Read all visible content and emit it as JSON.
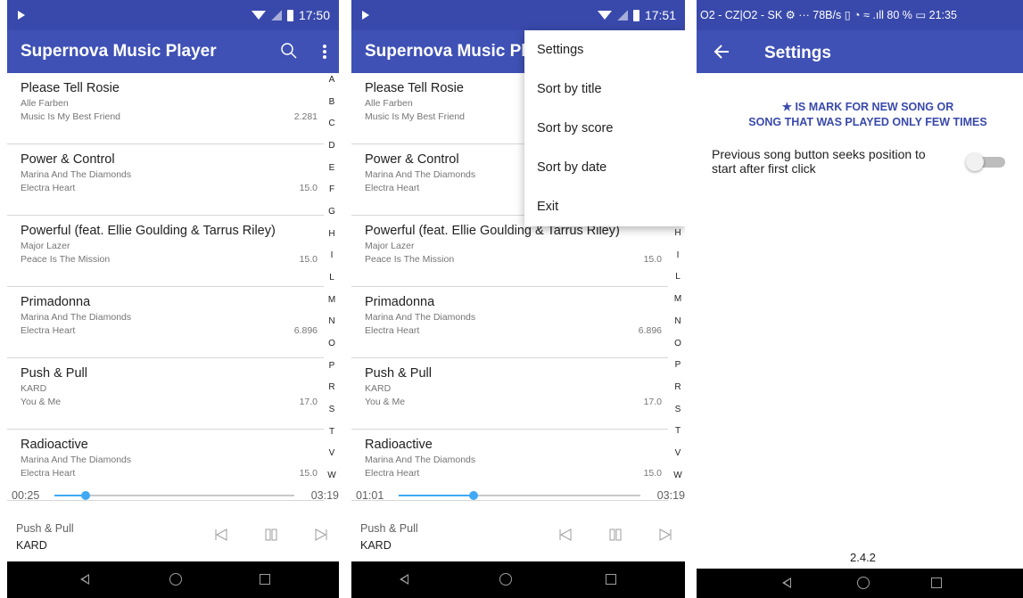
{
  "colors": {
    "primary": "#3f51b5",
    "status_bar": "#3949ab",
    "accent": "#3fa9f5",
    "nav_bar": "#000000"
  },
  "screen1": {
    "status_time": "17:50",
    "app_title": "Supernova Music Player",
    "songs": [
      {
        "title": "Please Tell Rosie",
        "artist": "Alle Farben",
        "album": "Music Is My Best Friend",
        "score": "2.281"
      },
      {
        "title": "Power & Control",
        "artist": "Marina And The Diamonds",
        "album": "Electra Heart",
        "score": "15.0"
      },
      {
        "title": "Powerful (feat. Ellie Goulding & Tarrus Riley)",
        "artist": "Major Lazer",
        "album": "Peace Is The Mission",
        "score": "15.0"
      },
      {
        "title": "Primadonna",
        "artist": "Marina And The Diamonds",
        "album": "Electra Heart",
        "score": "6.896"
      },
      {
        "title": "Push & Pull",
        "artist": "KARD",
        "album": "You & Me",
        "score": "17.0"
      },
      {
        "title": "Radioactive",
        "artist": "Marina And The Diamonds",
        "album": "Electra Heart",
        "score": "15.0"
      }
    ],
    "alphabet": [
      "A",
      "B",
      "C",
      "D",
      "E",
      "F",
      "G",
      "H",
      "I",
      "L",
      "M",
      "N",
      "O",
      "P",
      "R",
      "S",
      "T",
      "V",
      "W"
    ],
    "elapsed": "00:25",
    "duration": "03:19",
    "progress_fraction": 0.13,
    "now_playing_title": "Push & Pull",
    "now_playing_artist": "KARD"
  },
  "screen2": {
    "status_time": "17:51",
    "app_title": "Supernova Music Player",
    "songs": [
      {
        "title": "Please Tell Rosie",
        "artist": "Alle Farben",
        "album": "Music Is My Best Friend",
        "score": ""
      },
      {
        "title": "Power & Control",
        "artist": "Marina And The Diamonds",
        "album": "Electra Heart",
        "score": ""
      },
      {
        "title": "Powerful (feat. Ellie Goulding & Tarrus Riley)",
        "artist": "Major Lazer",
        "album": "Peace Is The Mission",
        "score": "15.0"
      },
      {
        "title": "Primadonna",
        "artist": "Marina And The Diamonds",
        "album": "Electra Heart",
        "score": "6.896"
      },
      {
        "title": "Push & Pull",
        "artist": "KARD",
        "album": "You & Me",
        "score": "17.0"
      },
      {
        "title": "Radioactive",
        "artist": "Marina And The Diamonds",
        "album": "Electra Heart",
        "score": "15.0"
      }
    ],
    "alphabet": [
      "H",
      "I",
      "L",
      "M",
      "N",
      "O",
      "P",
      "R",
      "S",
      "T",
      "V",
      "W"
    ],
    "elapsed": "01:01",
    "duration": "03:19",
    "progress_fraction": 0.31,
    "now_playing_title": "Push & Pull",
    "now_playing_artist": "KARD",
    "menu": [
      "Settings",
      "Sort by title",
      "Sort by score",
      "Sort by date",
      "Exit"
    ]
  },
  "screen3": {
    "status_text": "O2 - CZ|O2 - SK ⚙ ··· 78B/s ▯ ◔ ≈ .ıll 80 % ▭ 21:35",
    "title": "Settings",
    "notice_line1": "★ IS MARK FOR NEW SONG OR",
    "notice_line2": "SONG THAT WAS PLAYED ONLY FEW TIMES",
    "pref_label": "Previous song button seeks position to start after first click",
    "pref_enabled": false,
    "version": "2.4.2"
  }
}
